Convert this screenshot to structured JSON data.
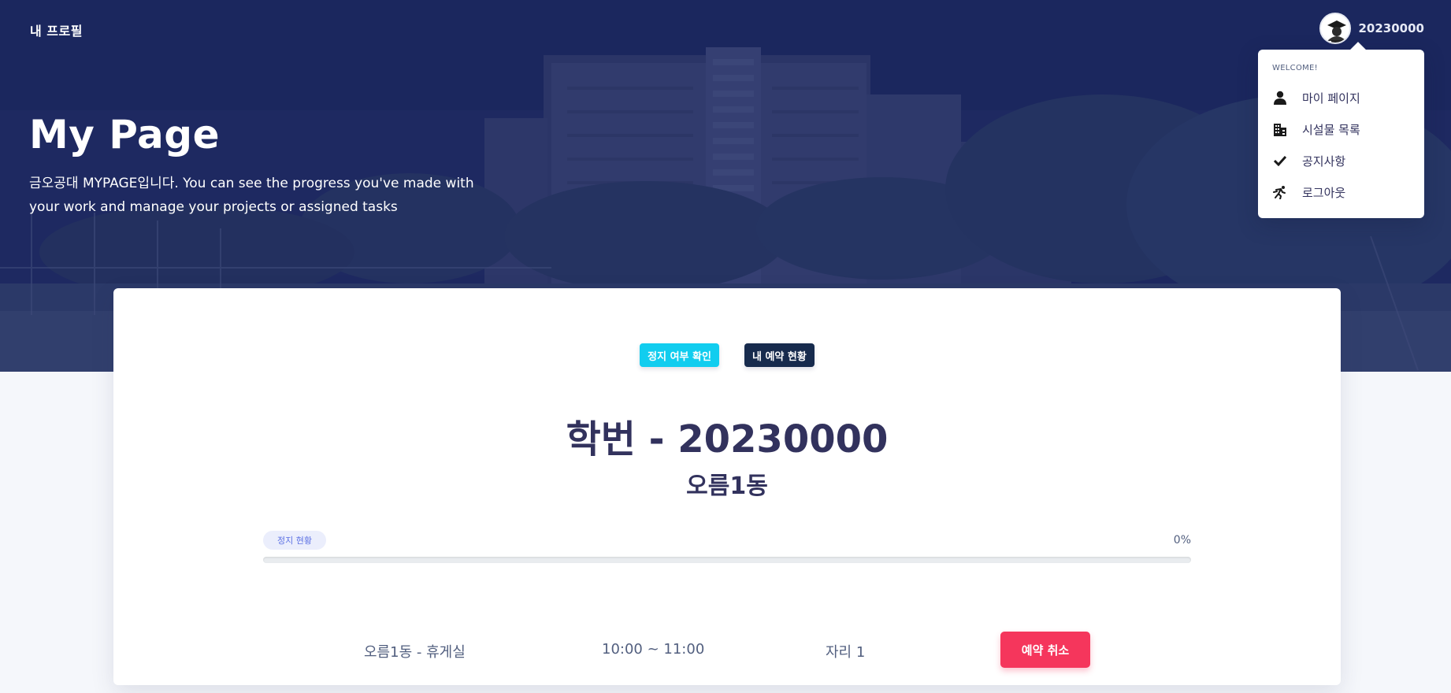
{
  "navbar": {
    "brand": "내 프로필",
    "user_id": "20230000"
  },
  "user_menu": {
    "header": "WELCOME!",
    "items": [
      {
        "label": "마이 페이지",
        "icon": "user-icon"
      },
      {
        "label": "시설물 목록",
        "icon": "building-icon"
      },
      {
        "label": "공지사항",
        "icon": "check-icon"
      },
      {
        "label": "로그아웃",
        "icon": "running-icon"
      }
    ]
  },
  "hero": {
    "title": "My Page",
    "description": "금오공대 MYPAGE입니다. You can see the progress you've made with your work and manage your projects or assigned tasks"
  },
  "card": {
    "buttons": {
      "check_suspension": "정지 여부 확인",
      "my_reservations": "내 예약 현황"
    },
    "student_id": "학번 - 20230000",
    "building": "오름1동",
    "progress": {
      "label": "정지 현황",
      "percent_text": "0%",
      "value": 0
    },
    "reservation": {
      "room": "오름1동 - 휴게실",
      "time": "10:00 ~ 11:00",
      "seat": "자리 1",
      "cancel_label": "예약 취소"
    }
  },
  "colors": {
    "info": "#11cdef",
    "dark": "#172b4d",
    "danger": "#f5365c",
    "primary": "#5e72e4",
    "heading": "#32325d"
  }
}
